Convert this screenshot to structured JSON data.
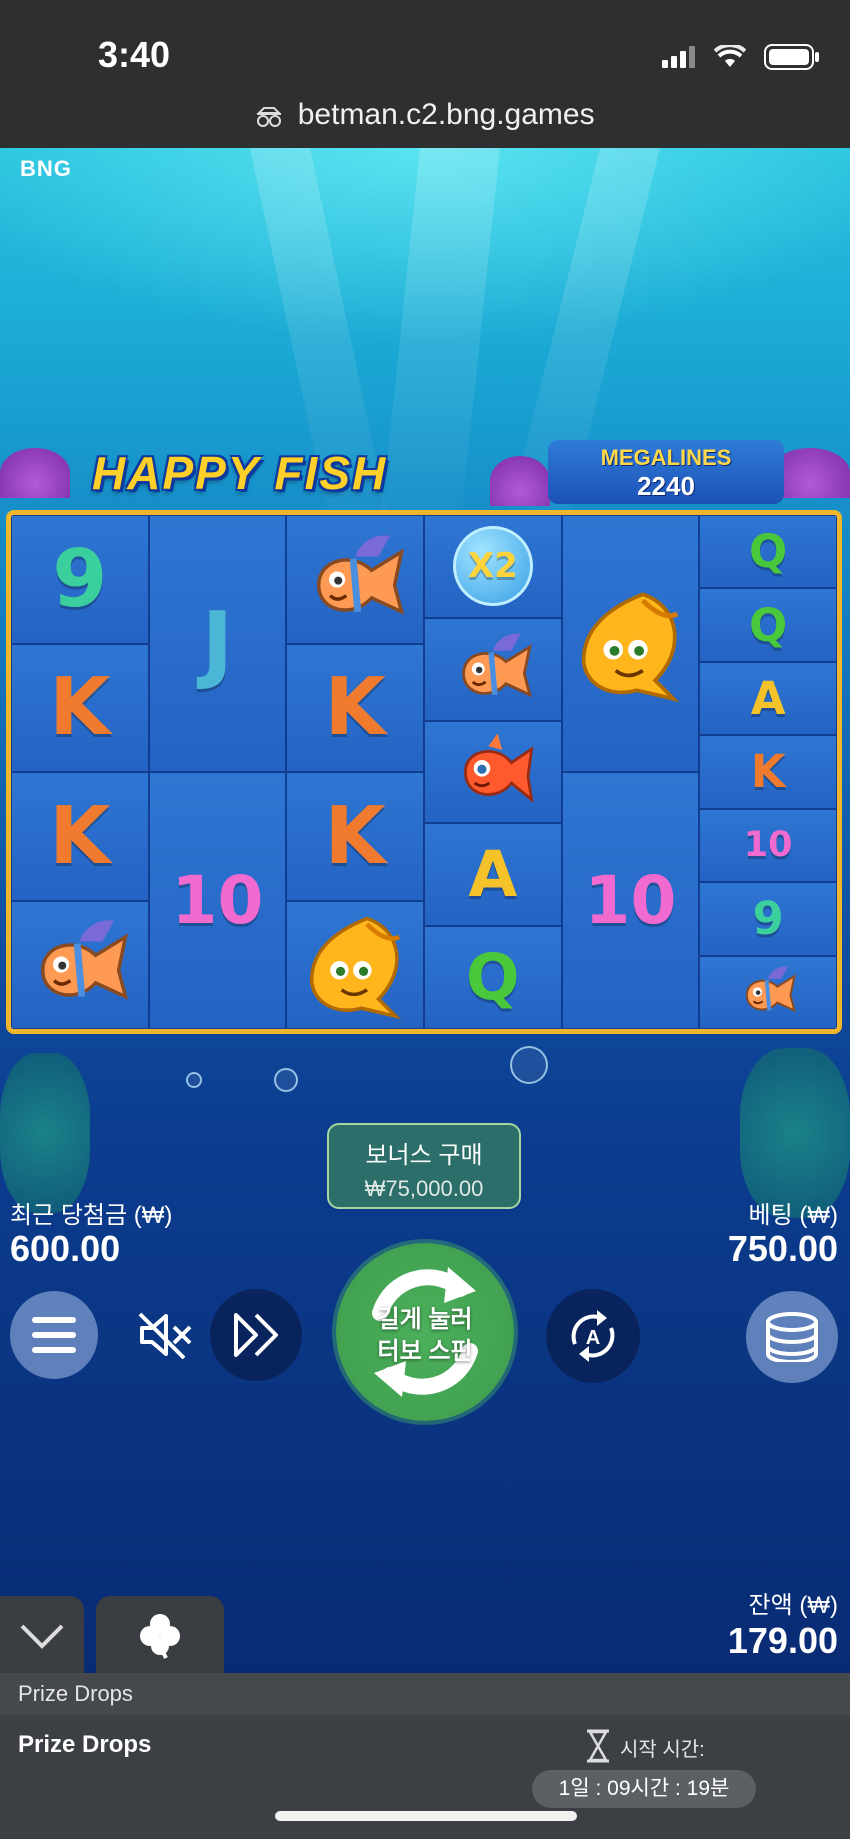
{
  "status_bar": {
    "time": "3:40",
    "url": "betman.c2.bng.games"
  },
  "game": {
    "provider": "BNG",
    "title": "HAPPY FISH",
    "megalines_label": "MEGALINES",
    "megalines_value": "2240",
    "reels": [
      [
        {
          "type": "text",
          "value": "9",
          "color": "#3ccf9e",
          "span": 1
        },
        {
          "type": "text",
          "value": "K",
          "color": "#f07a2d",
          "span": 1
        },
        {
          "type": "text",
          "value": "K",
          "color": "#f07a2d",
          "span": 1
        },
        {
          "type": "fish",
          "value": "clownfish",
          "color": "#ff9a55",
          "span": 1
        }
      ],
      [
        {
          "type": "text",
          "value": "J",
          "color": "#4bb6d6",
          "span": 2
        },
        {
          "type": "text",
          "value": "10",
          "color": "#f06ad0",
          "span": 2
        }
      ],
      [
        {
          "type": "fish",
          "value": "clownfish",
          "color": "#ff9a55",
          "span": 1
        },
        {
          "type": "text",
          "value": "K",
          "color": "#f07a2d",
          "span": 1
        },
        {
          "type": "text",
          "value": "K",
          "color": "#f07a2d",
          "span": 1
        },
        {
          "type": "fish",
          "value": "goldfish",
          "color": "#ffb51c",
          "span": 1
        }
      ],
      [
        {
          "type": "multiplier",
          "value": "X2",
          "color": "#ffd33a",
          "span": 1
        },
        {
          "type": "fish",
          "value": "clownfish",
          "color": "#ff9a55",
          "span": 1
        },
        {
          "type": "fish",
          "value": "red-fish",
          "color": "#ff5a2e",
          "span": 1
        },
        {
          "type": "text",
          "value": "A",
          "color": "#f5c22a",
          "span": 1
        },
        {
          "type": "text",
          "value": "Q",
          "color": "#49c83c",
          "span": 1
        }
      ],
      [
        {
          "type": "fish",
          "value": "goldfish",
          "color": "#ffb51c",
          "span": 2
        },
        {
          "type": "text",
          "value": "10",
          "color": "#f06ad0",
          "span": 2
        }
      ],
      [
        {
          "type": "text",
          "value": "Q",
          "color": "#49c83c",
          "span": 1
        },
        {
          "type": "text",
          "value": "Q",
          "color": "#49c83c",
          "span": 1
        },
        {
          "type": "text",
          "value": "A",
          "color": "#f5c22a",
          "span": 1
        },
        {
          "type": "text",
          "value": "K",
          "color": "#f07a2d",
          "span": 1
        },
        {
          "type": "text",
          "value": "10",
          "color": "#f06ad0",
          "span": 1
        },
        {
          "type": "text",
          "value": "9",
          "color": "#3ccf9e",
          "span": 1
        },
        {
          "type": "fish",
          "value": "clownfish",
          "color": "#ff9a55",
          "span": 1
        }
      ]
    ],
    "bonus_buy": {
      "title": "보너스 구매",
      "price": "₩75,000.00"
    },
    "last_win": {
      "label": "최근 당첨금 (₩)",
      "value": "600.00"
    },
    "bet": {
      "label": "베팅 (₩)",
      "value": "750.00"
    },
    "spin": {
      "line1": "길게 눌러",
      "line2": "터보 스핀"
    },
    "balance": {
      "label": "잔액 (₩)",
      "value": "179.00"
    },
    "controls": [
      "menu-icon",
      "sound-off-icon",
      "turbo-icon",
      "autoplay-icon",
      "coins-icon"
    ]
  },
  "prize_drops": {
    "header": "Prize Drops",
    "title": "Prize Drops",
    "start_label": "시작 시간:",
    "timer": "1일 : 09시간 : 19분"
  },
  "colors": {
    "reel_border": "#f2b62c",
    "spin_green": "#4cb05c"
  }
}
